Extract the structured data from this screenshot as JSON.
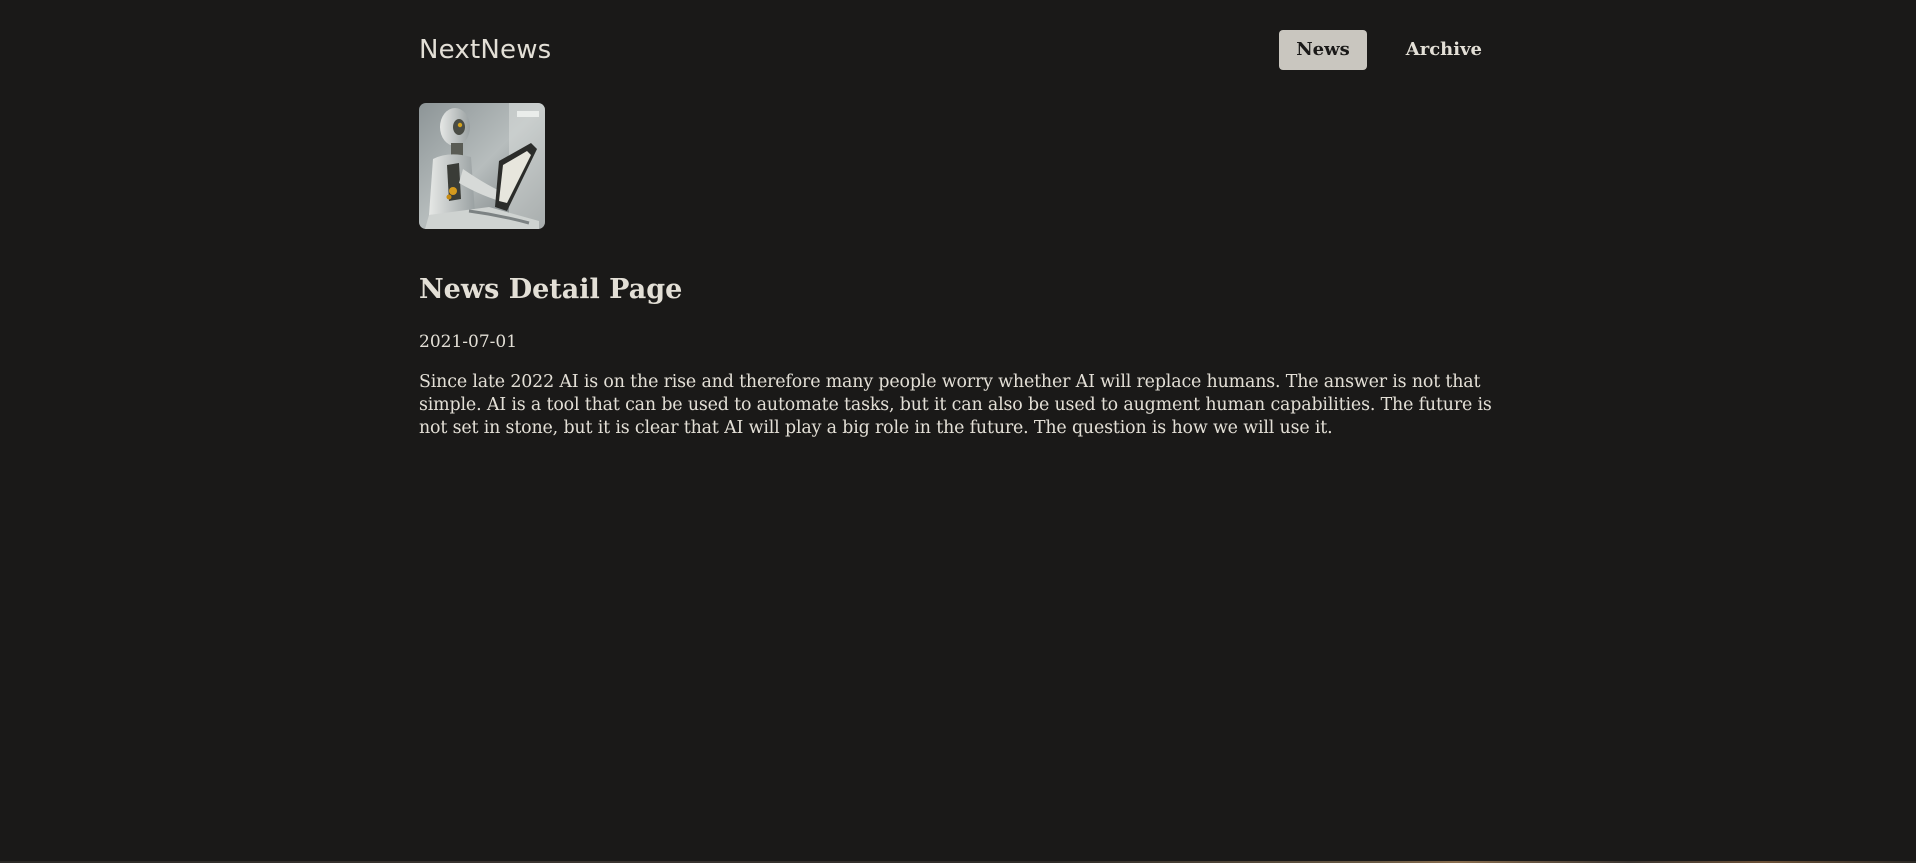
{
  "header": {
    "brand": "NextNews",
    "nav": [
      {
        "label": "News",
        "active": true
      },
      {
        "label": "Archive",
        "active": false
      }
    ]
  },
  "article": {
    "image_alt": "robot holding a tablet",
    "title": "News Detail Page",
    "date": "2021-07-01",
    "body": "Since late 2022 AI is on the rise and therefore many people worry whether AI will replace humans. The answer is not that simple. AI is a tool that can be used to automate tasks, but it can also be used to augment human capabilities. The future is not set in stone, but it is clear that AI will play a big role in the future. The question is how we will use it."
  },
  "colors": {
    "background": "#1a1918",
    "text": "#e3dfd6",
    "active_nav_bg": "#c9c6bf",
    "active_nav_text": "#1a1918"
  }
}
